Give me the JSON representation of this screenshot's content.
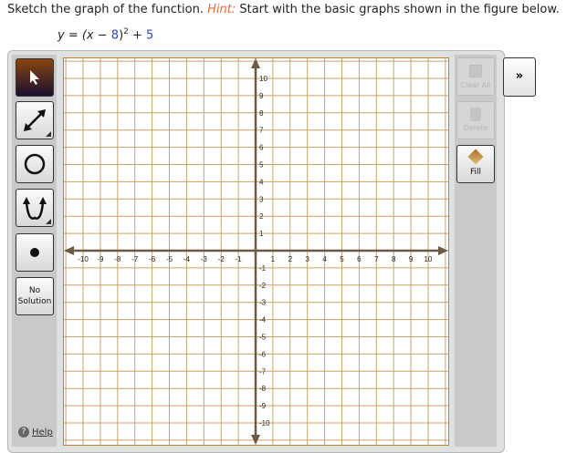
{
  "question": {
    "text": "Sketch the graph of the function.",
    "hint_label": "Hint:",
    "hint_text": "Start with the basic graphs shown in the figure below."
  },
  "equation": {
    "lhs": "y = (x − ",
    "h": "8",
    "rp": ")",
    "exp": "2",
    "plus": " + ",
    "k": "5"
  },
  "tools": {
    "no_solution_1": "No",
    "no_solution_2": "Solution",
    "help": "Help"
  },
  "right_tools": {
    "clear_all": "Clear All",
    "delete": "Delete",
    "fill": "Fill",
    "more": "»"
  },
  "graph": {
    "xmin": -10,
    "xmax": 10,
    "ymin": -10,
    "ymax": 10,
    "x_ticks": [
      "-10",
      "-9",
      "-8",
      "-7",
      "-6",
      "-5",
      "-4",
      "-3",
      "-2",
      "-1",
      "1",
      "2",
      "3",
      "4",
      "5",
      "6",
      "7",
      "8",
      "9",
      "10"
    ],
    "y_ticks": [
      "10",
      "9",
      "8",
      "7",
      "6",
      "5",
      "4",
      "3",
      "2",
      "1",
      "-1",
      "-2",
      "-3",
      "-4",
      "-5",
      "-6",
      "-7",
      "-8",
      "-9",
      "-10"
    ]
  },
  "colors": {
    "grid": "#c9a36a",
    "axis": "#6b5a45",
    "border": "#b8863c",
    "hint": "#e8693a"
  }
}
